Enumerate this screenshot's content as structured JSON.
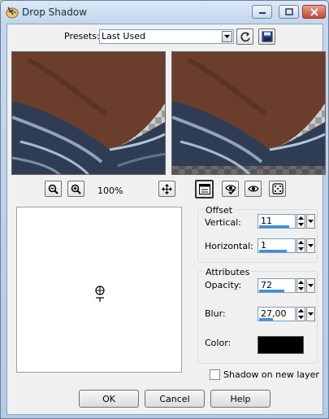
{
  "window": {
    "title": "Drop Shadow"
  },
  "presets": {
    "label": "Presets:",
    "value": "Last Used"
  },
  "preview": {
    "zoom": "100%"
  },
  "offset": {
    "title": "Offset",
    "vertical_label": "Vertical:",
    "vertical_value": "11",
    "vertical_level": 0.85,
    "horizontal_label": "Horizontal:",
    "horizontal_value": "1",
    "horizontal_level": 0.8
  },
  "attributes": {
    "title": "Attributes",
    "opacity_label": "Opacity:",
    "opacity_value": "72",
    "opacity_level": 0.72,
    "blur_label": "Blur:",
    "blur_value": "27,00",
    "blur_level": 0.4,
    "color_label": "Color:",
    "color_value": "#000000"
  },
  "shadow_layer": {
    "label": "Shadow on new layer",
    "checked": false
  },
  "buttons": {
    "ok": "OK",
    "cancel": "Cancel",
    "help": "Help"
  }
}
